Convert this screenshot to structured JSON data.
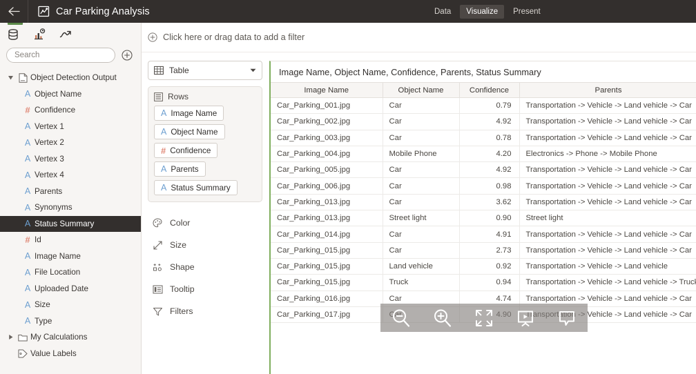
{
  "topbar": {
    "back_label": "←",
    "title": "Car Parking Analysis",
    "title_icon": "chart-document-icon",
    "nav": [
      {
        "label": "Data",
        "active": false
      },
      {
        "label": "Visualize",
        "active": true
      },
      {
        "label": "Present",
        "active": false
      }
    ]
  },
  "left_panel": {
    "tabs": [
      {
        "name": "data-tab",
        "icon": "database-icon",
        "active": true
      },
      {
        "name": "analytics-tab",
        "icon": "bar-chart-badge-icon",
        "active": false
      },
      {
        "name": "trends-tab",
        "icon": "trend-line-icon",
        "active": false
      }
    ],
    "search": {
      "placeholder": "Search",
      "value": ""
    },
    "add_button_icon": "plus-circle-icon",
    "tree": [
      {
        "label": "Object Detection Output",
        "level": 1,
        "icon": "dataset-icon",
        "caret": "expanded",
        "selected": false
      },
      {
        "label": "Object Name",
        "level": 2,
        "icon": "text-field-icon",
        "selected": false
      },
      {
        "label": "Confidence",
        "level": 2,
        "icon": "number-field-icon",
        "selected": false
      },
      {
        "label": "Vertex 1",
        "level": 2,
        "icon": "text-field-icon",
        "selected": false
      },
      {
        "label": "Vertex 2",
        "level": 2,
        "icon": "text-field-icon",
        "selected": false
      },
      {
        "label": "Vertex 3",
        "level": 2,
        "icon": "text-field-icon",
        "selected": false
      },
      {
        "label": "Vertex 4",
        "level": 2,
        "icon": "text-field-icon",
        "selected": false
      },
      {
        "label": "Parents",
        "level": 2,
        "icon": "text-field-icon",
        "selected": false
      },
      {
        "label": "Synonyms",
        "level": 2,
        "icon": "text-field-icon",
        "selected": false
      },
      {
        "label": "Status Summary",
        "level": 2,
        "icon": "text-field-icon",
        "selected": true
      },
      {
        "label": "Id",
        "level": 2,
        "icon": "number-field-icon",
        "selected": false
      },
      {
        "label": "Image Name",
        "level": 2,
        "icon": "text-field-icon",
        "selected": false
      },
      {
        "label": "File Location",
        "level": 2,
        "icon": "text-field-icon",
        "selected": false
      },
      {
        "label": "Uploaded Date",
        "level": 2,
        "icon": "text-field-icon",
        "selected": false
      },
      {
        "label": "Size",
        "level": 2,
        "icon": "text-field-icon",
        "selected": false
      },
      {
        "label": "Type",
        "level": 2,
        "icon": "text-field-icon",
        "selected": false
      },
      {
        "label": "My Calculations",
        "level": 1,
        "icon": "folder-icon",
        "caret": "collapsed",
        "selected": false
      },
      {
        "label": "Value Labels",
        "level": 1,
        "icon": "tag-icon",
        "caret": "none",
        "selected": false
      }
    ]
  },
  "filter_bar": {
    "icon": "plus-circle-icon",
    "text": "Click here or drag data to add a filter"
  },
  "shelf": {
    "viz_type": {
      "label": "Table",
      "icon": "table-icon",
      "chevron": "chevron-down-icon"
    },
    "rows_shelf": {
      "label": "Rows",
      "icon": "rows-icon",
      "pills": [
        {
          "label": "Image Name",
          "icon": "text-field-icon"
        },
        {
          "label": "Object Name",
          "icon": "text-field-icon"
        },
        {
          "label": "Confidence",
          "icon": "number-field-icon"
        },
        {
          "label": "Parents",
          "icon": "text-field-icon"
        },
        {
          "label": "Status Summary",
          "icon": "text-field-icon"
        }
      ]
    },
    "encodings": [
      {
        "label": "Color",
        "icon": "palette-icon"
      },
      {
        "label": "Size",
        "icon": "resize-icon"
      },
      {
        "label": "Shape",
        "icon": "shapes-icon"
      },
      {
        "label": "Tooltip",
        "icon": "tooltip-icon"
      },
      {
        "label": "Filters",
        "icon": "funnel-icon"
      }
    ]
  },
  "viz": {
    "title": "Image Name, Object Name, Confidence, Parents, Status Summary",
    "columns": [
      "Image Name",
      "Object Name",
      "Confidence",
      "Parents"
    ],
    "rows": [
      [
        "Car_Parking_001.jpg",
        "Car",
        "0.79",
        "Transportation -> Vehicle -> Land vehicle -> Car"
      ],
      [
        "Car_Parking_002.jpg",
        "Car",
        "4.92",
        "Transportation -> Vehicle -> Land vehicle -> Car"
      ],
      [
        "Car_Parking_003.jpg",
        "Car",
        "0.78",
        "Transportation -> Vehicle -> Land vehicle -> Car"
      ],
      [
        "Car_Parking_004.jpg",
        "Mobile Phone",
        "4.20",
        "Electronics -> Phone -> Mobile Phone"
      ],
      [
        "Car_Parking_005.jpg",
        "Car",
        "4.92",
        "Transportation -> Vehicle -> Land vehicle -> Car"
      ],
      [
        "Car_Parking_006.jpg",
        "Car",
        "0.98",
        "Transportation -> Vehicle -> Land vehicle -> Car"
      ],
      [
        "Car_Parking_013.jpg",
        "Car",
        "3.62",
        "Transportation -> Vehicle -> Land vehicle -> Car"
      ],
      [
        "Car_Parking_013.jpg",
        "Street light",
        "0.90",
        "Street light"
      ],
      [
        "Car_Parking_014.jpg",
        "Car",
        "4.91",
        "Transportation -> Vehicle -> Land vehicle -> Car"
      ],
      [
        "Car_Parking_015.jpg",
        "Car",
        "2.73",
        "Transportation -> Vehicle -> Land vehicle -> Car"
      ],
      [
        "Car_Parking_015.jpg",
        "Land vehicle",
        "0.92",
        "Transportation -> Vehicle -> Land vehicle"
      ],
      [
        "Car_Parking_015.jpg",
        "Truck",
        "0.94",
        "Transportation -> Vehicle -> Land vehicle -> Truck"
      ],
      [
        "Car_Parking_016.jpg",
        "Car",
        "4.74",
        "Transportation -> Vehicle -> Land vehicle -> Car"
      ],
      [
        "Car_Parking_017.jpg",
        "Car",
        "4.90",
        "Transportation -> Vehicle -> Land vehicle -> Car"
      ]
    ]
  },
  "float_toolbar": {
    "buttons": [
      {
        "name": "zoom-out-button",
        "icon": "magnifier-minus-icon"
      },
      {
        "name": "zoom-in-button",
        "icon": "magnifier-plus-icon"
      },
      {
        "name": "fit-screen-button",
        "icon": "expand-arrows-icon"
      },
      {
        "name": "present-button",
        "icon": "presentation-icon"
      },
      {
        "name": "comment-button",
        "icon": "speech-bubble-icon"
      }
    ]
  },
  "colors": {
    "topbar_bg": "#332f2d",
    "accent_green": "#7fae5e",
    "text_field_blue": "#6d9fd0",
    "number_field_red": "#e08b7a",
    "panel_bg": "#f7f5f3"
  }
}
